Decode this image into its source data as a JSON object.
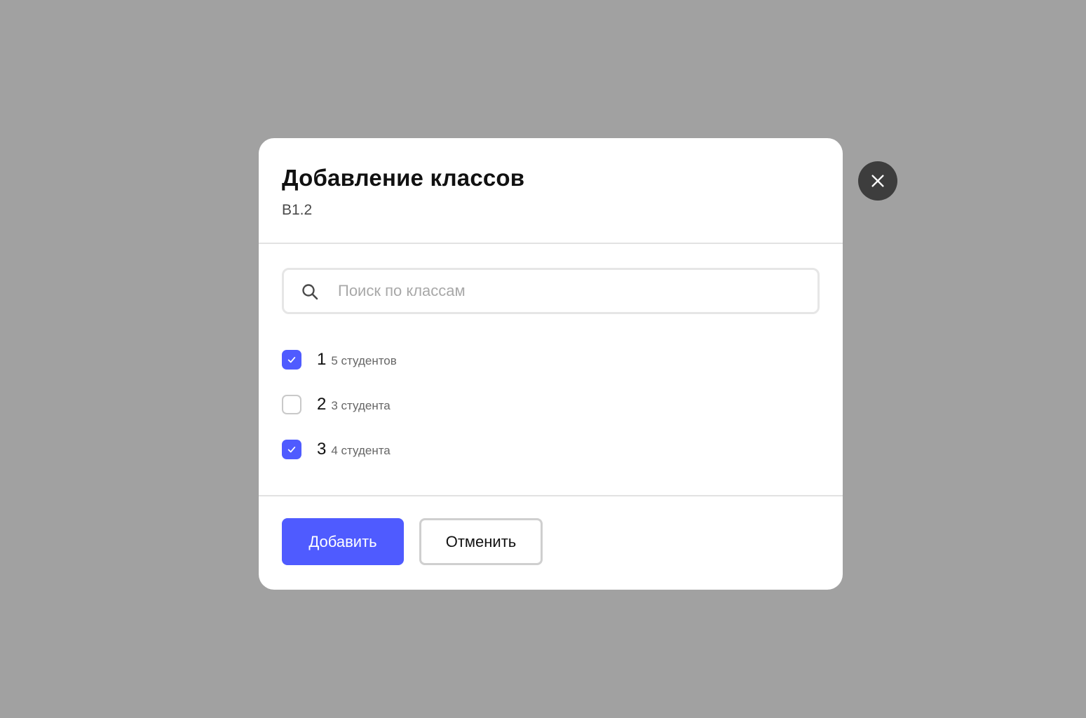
{
  "modal": {
    "title": "Добавление классов",
    "subtitle": "B1.2"
  },
  "search": {
    "placeholder": "Поиск по классам",
    "value": "",
    "icon": "search-icon"
  },
  "classes": [
    {
      "name": "1",
      "count": "5 студентов",
      "checked": true
    },
    {
      "name": "2",
      "count": "3 студента",
      "checked": false
    },
    {
      "name": "3",
      "count": "4 студента",
      "checked": true
    }
  ],
  "footer": {
    "add_label": "Добавить",
    "cancel_label": "Отменить"
  },
  "close": {
    "icon": "close-icon"
  },
  "colors": {
    "accent": "#4f5bff",
    "overlay": "#a1a1a1",
    "close_bg": "#3d3d3d"
  }
}
